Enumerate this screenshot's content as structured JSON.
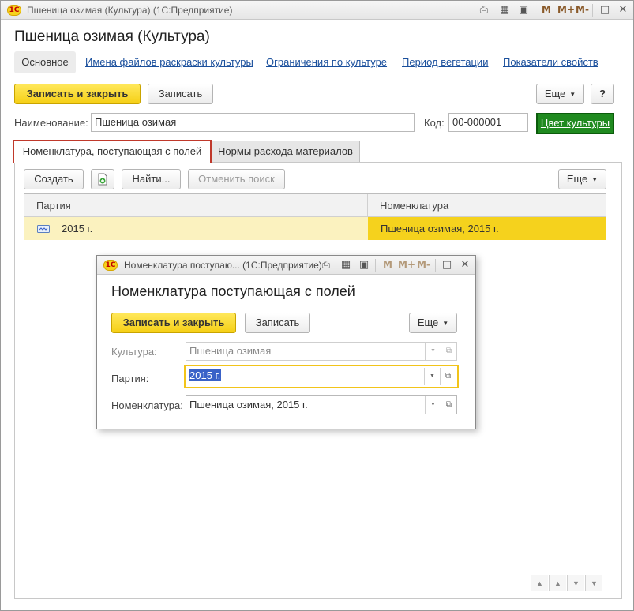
{
  "window": {
    "title": "Пшеница озимая (Культура)  (1С:Предприятие)",
    "logo": "1С",
    "m_labels": [
      "M",
      "M+",
      "M-"
    ],
    "icons": [
      "print-icon",
      "calculator-icon",
      "calendar-icon",
      "minimize-icon",
      "maximize-icon",
      "close-icon"
    ]
  },
  "form": {
    "title": "Пшеница озимая (Культура)",
    "nav": {
      "active": "Основное",
      "links": [
        "Имена файлов раскраски культуры",
        "Ограничения по культуре",
        "Период вегетации",
        "Показатели свойств"
      ]
    },
    "toolbar": {
      "save_close": "Записать и закрыть",
      "save": "Записать",
      "more": "Еще",
      "help": "?"
    },
    "name_label": "Наименование:",
    "name_value": "Пшеница озимая",
    "code_label": "Код:",
    "code_value": "00-000001",
    "color_button": "Цвет культуры",
    "tabs": [
      "Номенклатура, поступающая с полей",
      "Нормы расхода материалов"
    ],
    "grid_toolbar": {
      "create": "Создать",
      "find": "Найти...",
      "cancel_search": "Отменить поиск",
      "more": "Еще"
    },
    "grid": {
      "columns": [
        "Партия",
        "Номенклатура"
      ],
      "rows": [
        {
          "batch": "2015 г.",
          "nomenclature": "Пшеница озимая, 2015 г."
        }
      ]
    }
  },
  "dialog": {
    "title": "Номенклатура поступаю... (1С:Предприятие)",
    "m_labels": [
      "M",
      "M+",
      "M-"
    ],
    "heading": "Номенклатура поступающая с полей",
    "save_close": "Записать и закрыть",
    "save": "Записать",
    "more": "Еще",
    "fields": {
      "culture_label": "Культура:",
      "culture_value": "Пшеница озимая",
      "batch_label": "Партия:",
      "batch_value": "2015 г.",
      "nomenclature_label": "Номенклатура:",
      "nomenclature_value": "Пшеница озимая, 2015 г."
    }
  },
  "colors": {
    "accent_yellow": "#f5cf16",
    "link_blue": "#1a4f9c",
    "color_button_green": "#1f8a1f",
    "tab_active_border": "#c0392b",
    "row_highlight": "#fbf2bf",
    "selection_blue": "#3a62c8"
  }
}
